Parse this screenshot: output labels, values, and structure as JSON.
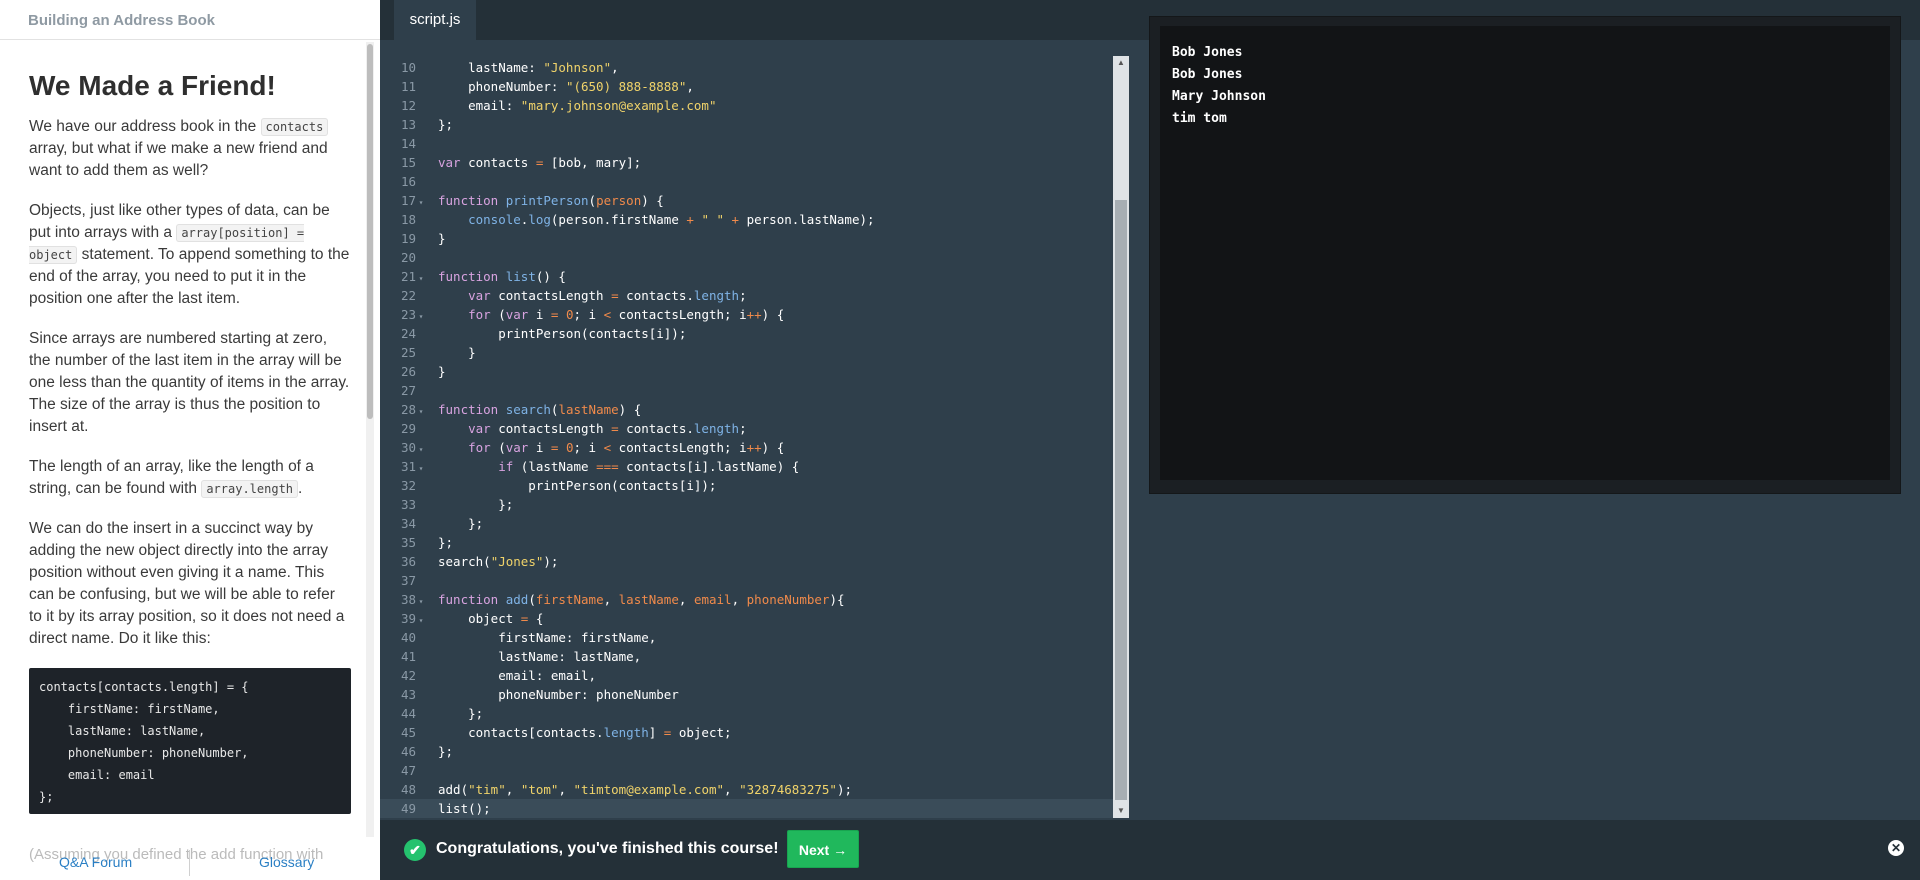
{
  "course": {
    "title": "Building an Address Book"
  },
  "lesson": {
    "heading": "We Made a Friend!",
    "p1": {
      "a": "We have our address book in the ",
      "code": "contacts",
      "b": " array, but what if we make a new friend and want to add them as well?"
    },
    "p2": {
      "a": "Objects, just like other types of data, can be put into arrays with a ",
      "code": "array[position] = object",
      "b": " statement. To append something to the end of the array, you need to put it in the position one after the last item."
    },
    "p3": "Since arrays are numbered starting at zero, the number of the last item in the array will be one less than the quantity of items in the array. The size of the array is thus the position to insert at.",
    "p4": {
      "a": "The length of an array, like the length of a string, can be found with ",
      "code": "array.length",
      "b": "."
    },
    "p5": "We can do the insert in a succinct way by adding the new object directly into the array position without even giving it a name. This can be confusing, but we will be able to refer to it by its array position, so it does not need a direct name. Do it like this:",
    "code_example": "contacts[contacts.length] = {\n    firstName: firstName,\n    lastName: lastName,\n    phoneNumber: phoneNumber,\n    email: email\n};",
    "overflow_text": "(Assuming you defined the add function with"
  },
  "footer": {
    "forum": "Q&A Forum",
    "glossary": "Glossary"
  },
  "editor": {
    "tab": "script.js",
    "lines": [
      [
        10,
        "    lastName: \"Johnson\","
      ],
      [
        11,
        "    phoneNumber: \"(650) 888-8888\","
      ],
      [
        12,
        "    email: \"mary.johnson@example.com\""
      ],
      [
        13,
        "};"
      ],
      [
        14,
        ""
      ],
      [
        15,
        "var contacts = [bob, mary];"
      ],
      [
        16,
        ""
      ],
      [
        17,
        "function printPerson(person) {"
      ],
      [
        18,
        "    console.log(person.firstName + \" \" + person.lastName);"
      ],
      [
        19,
        "}"
      ],
      [
        20,
        ""
      ],
      [
        21,
        "function list() {"
      ],
      [
        22,
        "    var contactsLength = contacts.length;"
      ],
      [
        23,
        "    for (var i = 0; i < contactsLength; i++) {"
      ],
      [
        24,
        "        printPerson(contacts[i]);"
      ],
      [
        25,
        "    }"
      ],
      [
        26,
        "}"
      ],
      [
        27,
        ""
      ],
      [
        28,
        "function search(lastName) {"
      ],
      [
        29,
        "    var contactsLength = contacts.length;"
      ],
      [
        30,
        "    for (var i = 0; i < contactsLength; i++) {"
      ],
      [
        31,
        "        if (lastName === contacts[i].lastName) {"
      ],
      [
        32,
        "            printPerson(contacts[i]);"
      ],
      [
        33,
        "        };"
      ],
      [
        34,
        "    };"
      ],
      [
        35,
        "};"
      ],
      [
        36,
        "search(\"Jones\");"
      ],
      [
        37,
        ""
      ],
      [
        38,
        "function add(firstName, lastName, email, phoneNumber){"
      ],
      [
        39,
        "    object = {"
      ],
      [
        40,
        "        firstName: firstName,"
      ],
      [
        41,
        "        lastName: lastName,"
      ],
      [
        42,
        "        email: email,"
      ],
      [
        43,
        "        phoneNumber: phoneNumber"
      ],
      [
        44,
        "    };"
      ],
      [
        45,
        "    contacts[contacts.length] = object;"
      ],
      [
        46,
        "};"
      ],
      [
        47,
        ""
      ],
      [
        48,
        "add(\"tim\", \"tom\", \"timtom@example.com\", \"32874683275\");"
      ],
      [
        49,
        "list();"
      ]
    ],
    "fold_lines": [
      17,
      21,
      23,
      28,
      30,
      31,
      38,
      39
    ],
    "current_line": 49
  },
  "output": {
    "lines": [
      "Bob Jones",
      "Bob Jones",
      "Mary Johnson",
      "tim tom"
    ]
  },
  "bottom": {
    "congrats": "Congratulations, you've finished this course!",
    "next": "Next →",
    "check": "✔",
    "close": "✕"
  },
  "colors": {
    "accent_green": "#20b85c",
    "editor_bg": "#2f3f4b",
    "toolbar_bg": "#243038"
  }
}
